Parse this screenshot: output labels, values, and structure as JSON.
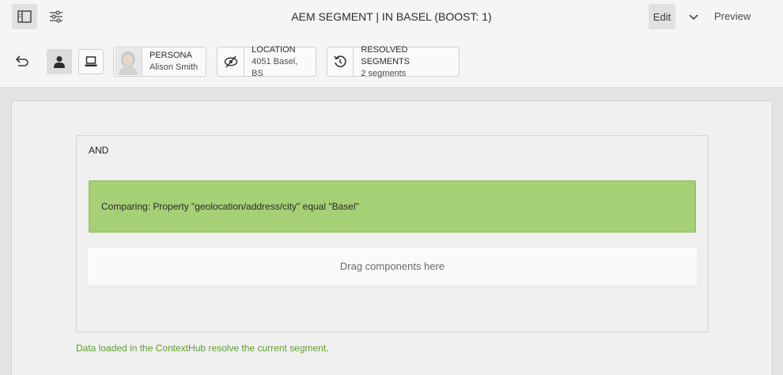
{
  "header": {
    "title": "AEM SEGMENT | IN BASEL (BOOST: 1)",
    "edit_label": "Edit",
    "preview_label": "Preview"
  },
  "toolbar": {
    "persona": {
      "label": "PERSONA",
      "value": "Alison Smith"
    },
    "location": {
      "label": "LOCATION",
      "value": "4051 Basel, BS"
    },
    "resolved": {
      "label": "RESOLVED SEGMENTS",
      "value": "2 segments"
    }
  },
  "editor": {
    "container_label": "AND",
    "rule_text": "Comparing: Property \"geolocation/address/city\" equal  \"Basel\"",
    "dropzone_text": "Drag components here",
    "status_text": "Data loaded in the ContextHub resolve the current segment.",
    "status_color": "#5e9d2c",
    "rule_color": "#a5d075"
  },
  "icons": [
    "side-panel-icon",
    "properties-icon",
    "undo-icon",
    "person-icon",
    "device-icon",
    "avatar",
    "location-icon",
    "refresh-icon",
    "chevron-down-icon"
  ]
}
